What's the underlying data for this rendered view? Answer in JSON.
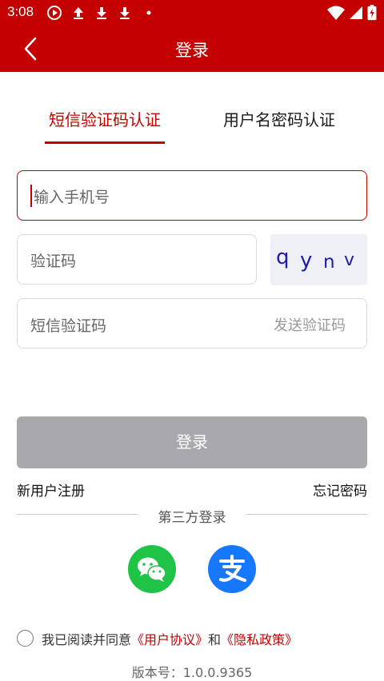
{
  "status_bar": {
    "time": "3:08",
    "left_icons": [
      "play-circle-icon",
      "upload-icon",
      "download-icon",
      "download-icon",
      "dot-icon"
    ],
    "right_icons": [
      "wifi-icon",
      "signal-icon",
      "battery-charging-icon"
    ]
  },
  "header": {
    "title": "登录",
    "background_color": "#c40000"
  },
  "tabs": [
    {
      "label": "短信验证码认证",
      "active": true
    },
    {
      "label": "用户名密码认证",
      "active": false
    }
  ],
  "form": {
    "phone_placeholder": "输入手机号",
    "captcha_placeholder": "验证码",
    "captcha_chars": [
      "q",
      "y",
      "n",
      "v"
    ],
    "sms_placeholder": "短信验证码",
    "send_code_label": "发送验证码"
  },
  "login_button": "登录",
  "links": {
    "register": "新用户注册",
    "forgot": "忘记密码"
  },
  "third_party": {
    "label": "第三方登录",
    "providers": [
      "wechat-icon",
      "alipay-icon"
    ]
  },
  "agreement": {
    "prefix": "我已阅读并同意",
    "user_agreement": "《用户协议》",
    "and": "和",
    "privacy_policy": "《隐私政策》"
  },
  "version": "版本号：1.0.0.9365",
  "colors": {
    "accent": "#c40000",
    "button_disabled": "#a8a8ad",
    "wechat": "#1fc446",
    "alipay": "#1677ff"
  }
}
